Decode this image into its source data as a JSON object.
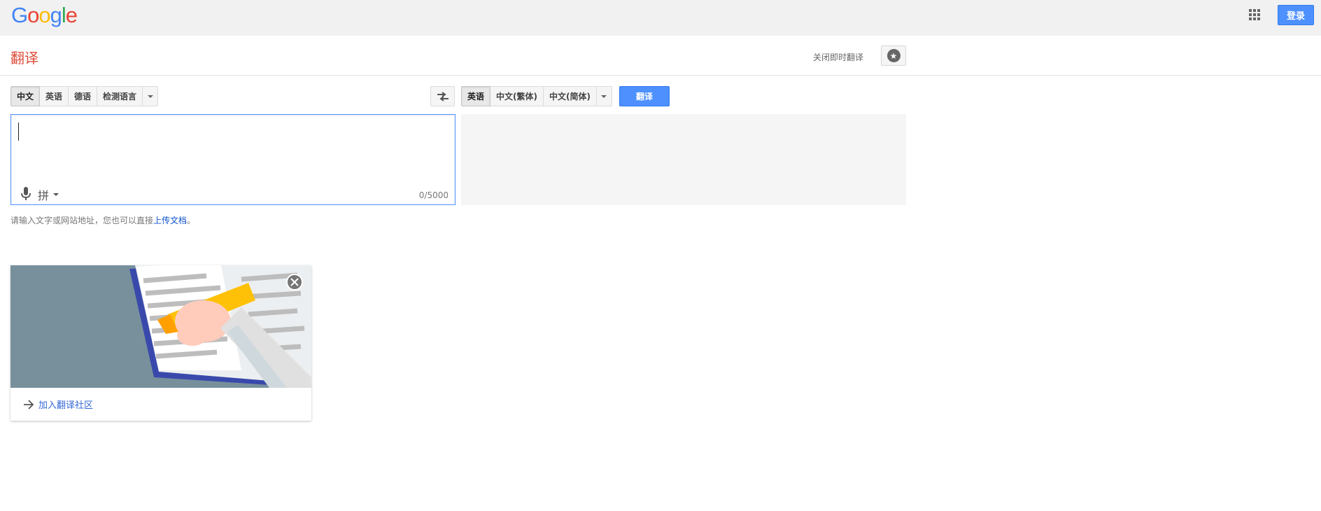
{
  "header": {
    "logo_letters": [
      {
        "ch": "G",
        "color": "#4285f4"
      },
      {
        "ch": "o",
        "color": "#ea4335"
      },
      {
        "ch": "o",
        "color": "#fbbc05"
      },
      {
        "ch": "g",
        "color": "#4285f4"
      },
      {
        "ch": "l",
        "color": "#34a853"
      },
      {
        "ch": "e",
        "color": "#ea4335"
      }
    ],
    "signin_label": "登录",
    "apps_icon": "apps-grid-icon"
  },
  "titlebar": {
    "title": "翻译",
    "instant_label": "关闭即时翻译",
    "star_icon": "star-icon"
  },
  "source_langs": {
    "items": [
      "中文",
      "英语",
      "德语",
      "检测语言"
    ],
    "active_index": 0
  },
  "target_langs": {
    "items": [
      "英语",
      "中文(繁体)",
      "中文(简体)"
    ],
    "active_index": 0
  },
  "swap_icon": "swap-languages-icon",
  "translate_label": "翻译",
  "source": {
    "value": "",
    "ime_label": "拼",
    "counter": "0/5000"
  },
  "hint": {
    "text": "请输入文字或网站地址，您也可以直接",
    "link": "上传文档",
    "suffix": "。"
  },
  "promo": {
    "link_label": "加入翻译社区",
    "arrow_icon": "arrow-right-icon",
    "close_icon": "close-icon"
  },
  "colors": {
    "accent_blue": "#4d90fe",
    "title_red": "#dd4b39",
    "link_blue": "#1155cc"
  }
}
